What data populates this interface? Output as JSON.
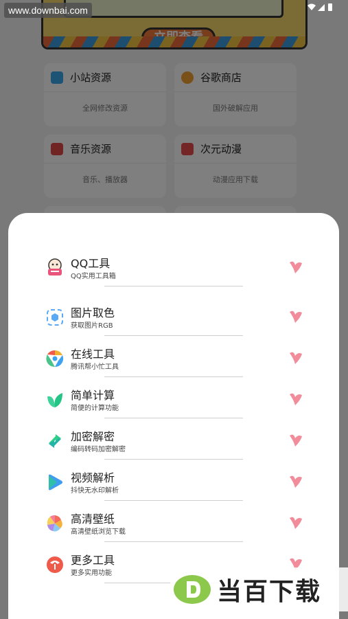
{
  "watermark_url": "www.downbai.com",
  "banner": {
    "button_label": "立即查看"
  },
  "cards": [
    {
      "title": "小站资源",
      "sub": "全网修改资源",
      "icon": "play-icon",
      "color": "#3aa6e8"
    },
    {
      "title": "谷歌商店",
      "sub": "国外破解应用",
      "icon": "pinwheel-icon",
      "color": "#f0a030"
    },
    {
      "title": "音乐资源",
      "sub": "音乐、播放器",
      "icon": "music-note-icon",
      "color": "#e04848"
    },
    {
      "title": "次元动漫",
      "sub": "动漫应用下载",
      "icon": "anime-icon",
      "color": "#e84a4a"
    }
  ],
  "sheet": {
    "items": [
      {
        "title": "QQ工具",
        "sub": "QQ实用工具箱",
        "icon": "qq-penguin-icon"
      },
      {
        "title": "图片取色",
        "sub": "获取图片RGB",
        "icon": "color-picker-icon"
      },
      {
        "title": "在线工具",
        "sub": "腾讯帮小忙工具",
        "icon": "chrome-like-icon"
      },
      {
        "title": "简单计算",
        "sub": "简便的计算功能",
        "icon": "leaf-icon"
      },
      {
        "title": "加密解密",
        "sub": "编码转码加密解密",
        "icon": "exchange-arrows-icon"
      },
      {
        "title": "视频解析",
        "sub": "抖快无水印解析",
        "icon": "video-play-icon"
      },
      {
        "title": "高清壁纸",
        "sub": "高清壁纸浏览下载",
        "icon": "petal-icon"
      },
      {
        "title": "更多工具",
        "sub": "更多实用功能",
        "icon": "more-tools-icon"
      }
    ]
  },
  "logo_text": "当百下载",
  "colors": {
    "favorite": "#f28b9a",
    "accent_green": "#2ecf8a"
  }
}
